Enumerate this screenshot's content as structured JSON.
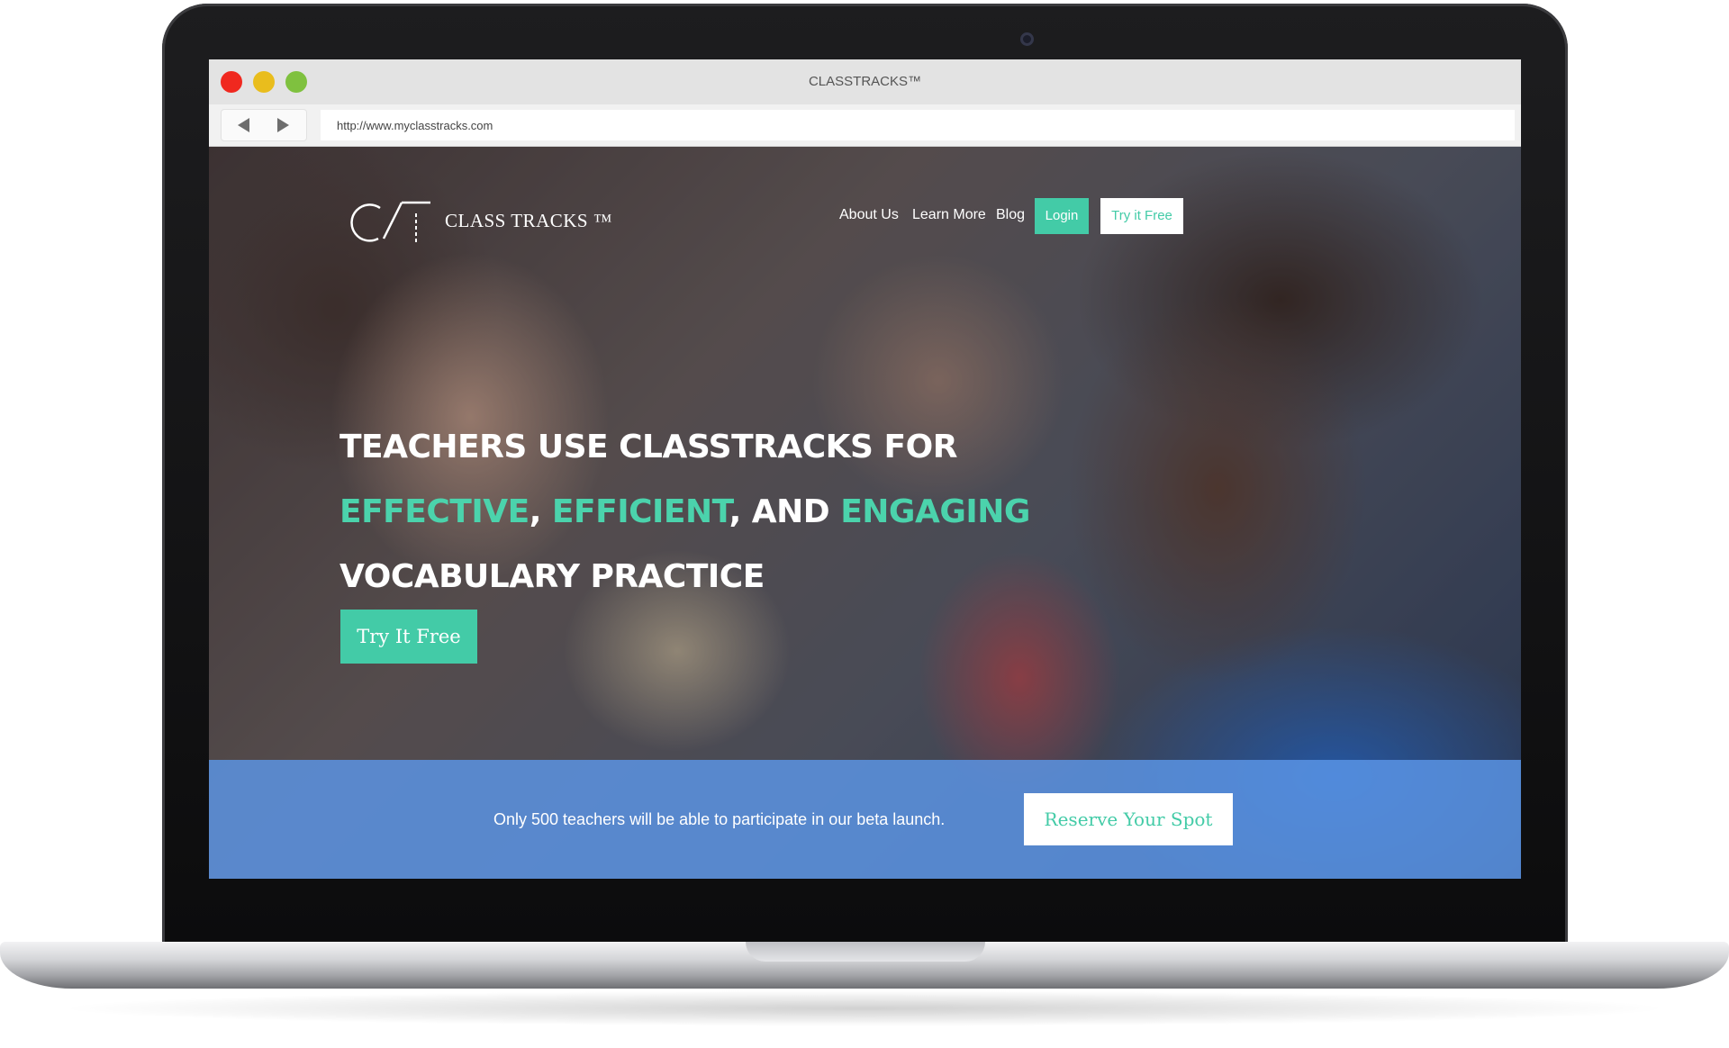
{
  "browser": {
    "window_title": "CLASSTRACKS™",
    "url": "http://www.myclasstracks.com"
  },
  "site": {
    "logo_text": "CLASS TRACKS ™",
    "nav": {
      "about": "About Us",
      "learn": "Learn More",
      "blog": "Blog",
      "login": "Login",
      "try": "Try it Free"
    },
    "headline": {
      "line1": "TEACHERS USE CLASSTRACKS FOR",
      "word1": "EFFECTIVE",
      "sep1": ", ",
      "word2": "EFFICIENT",
      "sep2": ", AND ",
      "word3": "ENGAGING",
      "line3": "VOCABULARY PRACTICE"
    },
    "cta_label": "Try It Free",
    "banner": {
      "text": "Only 500 teachers will be able to participate in our beta launch.",
      "button": "Reserve Your Spot"
    }
  },
  "colors": {
    "accent": "#43cba7",
    "banner": "#5c96e8",
    "close_dot": "#f0281f",
    "minimize_dot": "#e9bd1d",
    "zoom_dot": "#7fc13f"
  }
}
